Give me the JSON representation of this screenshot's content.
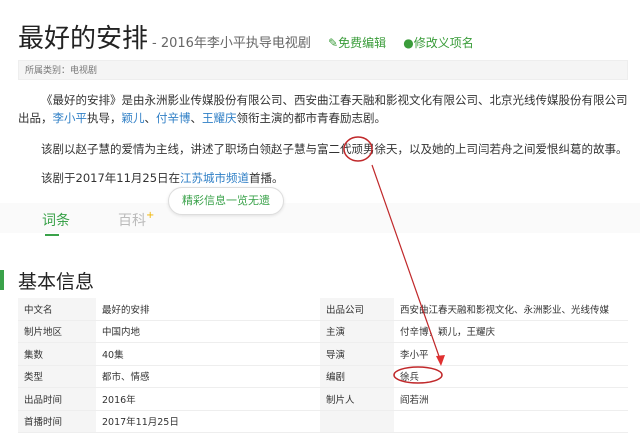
{
  "header": {
    "title": "最好的安排",
    "subtitle": "- 2016年李小平执导电视剧",
    "edit": "免费编辑",
    "rename": "修改义项名"
  },
  "category": "所属类别：电视剧",
  "para1": {
    "t1": "《最好的安排》是由永洲影业传媒股份有限公司、西安曲江春天融和影视文化有限公司、北京光线传媒股份有限公司出品，",
    "l1": "李小平",
    "t2": "执导，",
    "l2": "颖儿",
    "t3": "、",
    "l3": "付辛博",
    "t4": "、",
    "l4": "王耀庆",
    "t5": "领衔主演的都市青春励志剧。"
  },
  "para2": "该剧以赵子慧的爱情为主线，讲述了职场白领赵子慧与富二代顽男徐天，以及她的上司闫若舟之间爱恨纠葛的故事。",
  "para3": {
    "t1": "该剧于2017年11月25日在",
    "l1": "江苏城市频道",
    "t2": "首播。"
  },
  "tabs": {
    "entry": "词条",
    "baike": "百科",
    "plus": "+"
  },
  "tooltip": "精彩信息一览无遗",
  "section": "基本信息",
  "table": [
    [
      "中文名",
      "最好的安排",
      "出品公司",
      "西安曲江春天融和影视文化、永洲影业、光线传媒"
    ],
    [
      "制片地区",
      "中国内地",
      "主演",
      "付辛博，颖儿，王耀庆"
    ],
    [
      "集数",
      "40集",
      "导演",
      "李小平"
    ],
    [
      "类型",
      "都市、情感",
      "编剧",
      "徐兵"
    ],
    [
      "出品时间",
      "2016年",
      "制片人",
      "阎若洲"
    ],
    [
      "首播时间",
      "2017年11月25日",
      "",
      ""
    ]
  ],
  "annotation_color": "#c0282a"
}
